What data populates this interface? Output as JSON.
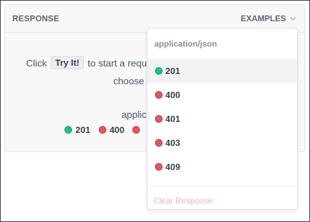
{
  "panel": {
    "title": "RESPONSE",
    "examples_label": "EXAMPLES"
  },
  "body": {
    "click_text": "Click",
    "try_it_label": "Try It!",
    "start_text": "to start a reque",
    "choose_text": "choose",
    "applic_text": "applic"
  },
  "status_codes_visible": [
    {
      "code": "201",
      "status": "success",
      "color": "#24c08a"
    },
    {
      "code": "400",
      "status": "error",
      "color": "#e25563"
    }
  ],
  "dropdown": {
    "header": "application/json",
    "items": [
      {
        "code": "201",
        "selected": true,
        "status": "success",
        "color": "#24c08a"
      },
      {
        "code": "400",
        "selected": false,
        "status": "error",
        "color": "#e25563"
      },
      {
        "code": "401",
        "selected": false,
        "status": "error",
        "color": "#e25563"
      },
      {
        "code": "403",
        "selected": false,
        "status": "error",
        "color": "#e25563"
      },
      {
        "code": "409",
        "selected": false,
        "status": "error",
        "color": "#e25563"
      }
    ],
    "clear_label": "Clear Response"
  }
}
